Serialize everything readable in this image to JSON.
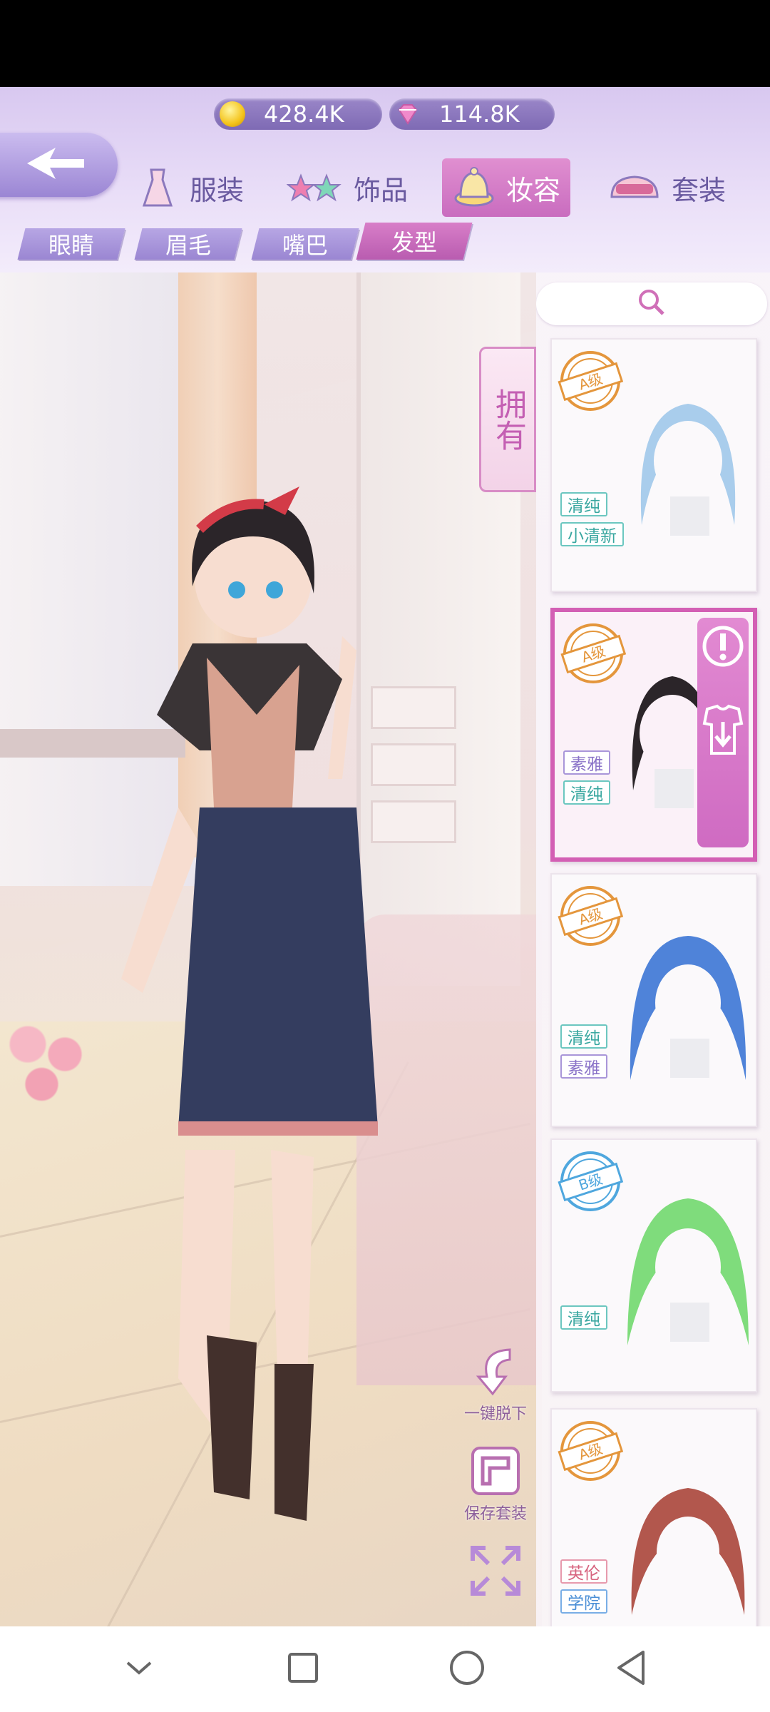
{
  "currency": {
    "coins": "428.4K",
    "gems": "114.8K"
  },
  "main_tabs": [
    {
      "label": "服装",
      "icon": "dress-icon",
      "active": false
    },
    {
      "label": "饰品",
      "icon": "stars-icon",
      "active": false
    },
    {
      "label": "妆容",
      "icon": "hat-icon",
      "active": true
    },
    {
      "label": "套装",
      "icon": "crown-icon",
      "active": false
    }
  ],
  "sub_tabs": [
    {
      "label": "眼睛",
      "active": false
    },
    {
      "label": "眉毛",
      "active": false
    },
    {
      "label": "嘴巴",
      "active": false
    },
    {
      "label": "发型",
      "active": true
    }
  ],
  "owned_tab": "拥有",
  "controls": {
    "undress_label": "一键脱下",
    "save_label": "保存套装"
  },
  "items": [
    {
      "grade": "A级",
      "tags": [
        "清纯",
        "小清新"
      ],
      "hair_color": "#a9cdec",
      "selected": false
    },
    {
      "grade": "A级",
      "tags": [
        "素雅",
        "清纯"
      ],
      "hair_color": "#2b2529",
      "selected": true
    },
    {
      "grade": "A级",
      "tags": [
        "清纯",
        "素雅"
      ],
      "hair_color": "#4f83d9",
      "selected": false
    },
    {
      "grade": "B级",
      "tags": [
        "清纯"
      ],
      "hair_color": "#7fdc7c",
      "selected": false
    },
    {
      "grade": "A级",
      "tags": [
        "英伦",
        "学院"
      ],
      "hair_color": "#b2574d",
      "selected": false
    }
  ],
  "colors": {
    "accent": "#d35fb4",
    "panel": "#d8c8f0",
    "tab_purple": "#9a86d2"
  }
}
